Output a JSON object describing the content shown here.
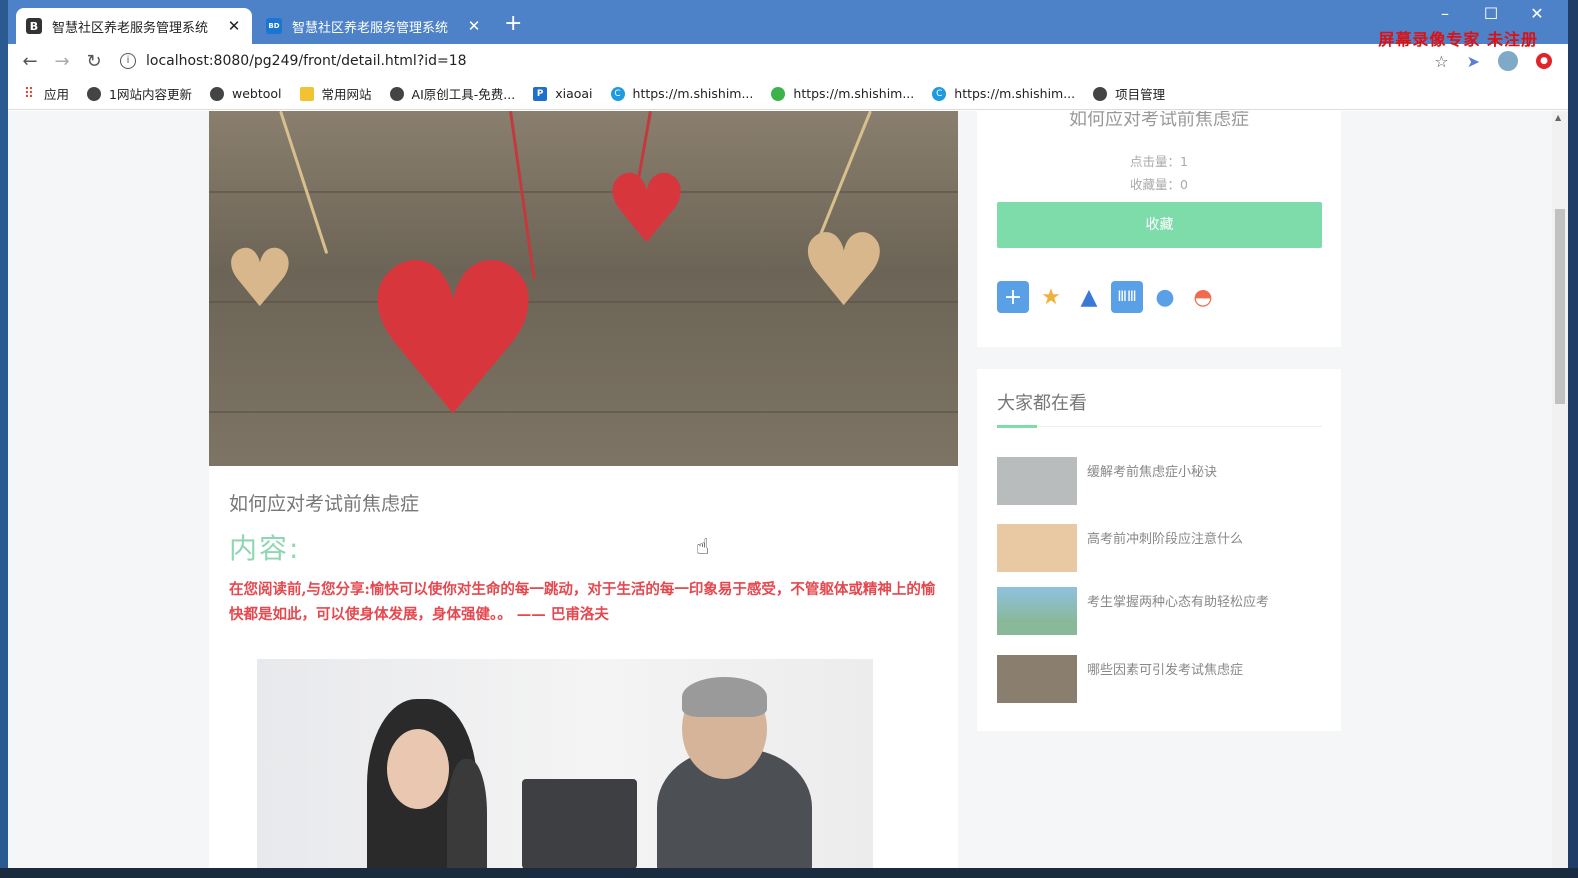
{
  "browser": {
    "tabs": [
      {
        "favicon": "B",
        "title": "智慧社区养老服务管理系统"
      },
      {
        "favicon": "BD",
        "title": "智慧社区养老服务管理系统"
      }
    ],
    "new_tab": "+",
    "url": "localhost:8080/pg249/front/detail.html?id=18",
    "watermark": "屏幕录像专家 未注册",
    "bookmarks": [
      {
        "icon": "apps-icon",
        "label": "应用"
      },
      {
        "icon": "globe-icon",
        "label": "1网站内容更新"
      },
      {
        "icon": "globe-icon",
        "label": "webtool"
      },
      {
        "icon": "folder-icon",
        "label": "常用网站"
      },
      {
        "icon": "globe-icon",
        "label": "AI原创工具-免费..."
      },
      {
        "icon": "p-icon",
        "label": "xiaoai"
      },
      {
        "icon": "c-icon",
        "label": "https://m.shishim..."
      },
      {
        "icon": "wechat-icon",
        "label": "https://m.shishim..."
      },
      {
        "icon": "c-icon",
        "label": "https://m.shishim..."
      },
      {
        "icon": "globe-icon",
        "label": "项目管理"
      }
    ]
  },
  "article": {
    "title": "如何应对考试前焦虑症",
    "content_label": "内容:",
    "quote": "在您阅读前,与您分享:愉快可以使你对生命的每一跳动，对于生活的每一印象易于感受，不管躯体或精神上的愉快都是如此，可以使身体发展，身体强健。。 ——  巴甫洛夫"
  },
  "sidebar": {
    "title": "如何应对考试前焦虑症",
    "clicks": "点击量：1",
    "favorites": "收藏量：0",
    "favorite_button": "收藏",
    "popular_heading": "大家都在看",
    "popular": [
      {
        "title": "缓解考前焦虑症小秘诀",
        "thumb_color": "#b9bcbd"
      },
      {
        "title": "高考前冲刺阶段应注意什么",
        "thumb_color": "#e9c9a3"
      },
      {
        "title": "考生掌握两种心态有助轻松应考",
        "thumb_color": "#89b99a"
      },
      {
        "title": "哪些因素可引发考试焦虑症",
        "thumb_color": "#8a7f6e"
      }
    ]
  },
  "colors": {
    "accent": "#7edbaa",
    "quote": "#e5484f",
    "titlebar": "#4d82c9"
  }
}
